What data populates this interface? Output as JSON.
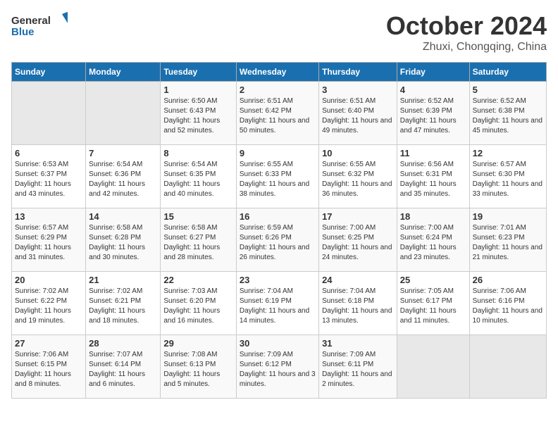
{
  "header": {
    "logo_line1": "General",
    "logo_line2": "Blue",
    "month": "October 2024",
    "location": "Zhuxi, Chongqing, China"
  },
  "weekdays": [
    "Sunday",
    "Monday",
    "Tuesday",
    "Wednesday",
    "Thursday",
    "Friday",
    "Saturday"
  ],
  "weeks": [
    [
      {
        "day": "",
        "empty": true
      },
      {
        "day": "",
        "empty": true
      },
      {
        "day": "1",
        "sunrise": "6:50 AM",
        "sunset": "6:43 PM",
        "daylight": "11 hours and 52 minutes."
      },
      {
        "day": "2",
        "sunrise": "6:51 AM",
        "sunset": "6:42 PM",
        "daylight": "11 hours and 50 minutes."
      },
      {
        "day": "3",
        "sunrise": "6:51 AM",
        "sunset": "6:40 PM",
        "daylight": "11 hours and 49 minutes."
      },
      {
        "day": "4",
        "sunrise": "6:52 AM",
        "sunset": "6:39 PM",
        "daylight": "11 hours and 47 minutes."
      },
      {
        "day": "5",
        "sunrise": "6:52 AM",
        "sunset": "6:38 PM",
        "daylight": "11 hours and 45 minutes."
      }
    ],
    [
      {
        "day": "6",
        "sunrise": "6:53 AM",
        "sunset": "6:37 PM",
        "daylight": "11 hours and 43 minutes."
      },
      {
        "day": "7",
        "sunrise": "6:54 AM",
        "sunset": "6:36 PM",
        "daylight": "11 hours and 42 minutes."
      },
      {
        "day": "8",
        "sunrise": "6:54 AM",
        "sunset": "6:35 PM",
        "daylight": "11 hours and 40 minutes."
      },
      {
        "day": "9",
        "sunrise": "6:55 AM",
        "sunset": "6:33 PM",
        "daylight": "11 hours and 38 minutes."
      },
      {
        "day": "10",
        "sunrise": "6:55 AM",
        "sunset": "6:32 PM",
        "daylight": "11 hours and 36 minutes."
      },
      {
        "day": "11",
        "sunrise": "6:56 AM",
        "sunset": "6:31 PM",
        "daylight": "11 hours and 35 minutes."
      },
      {
        "day": "12",
        "sunrise": "6:57 AM",
        "sunset": "6:30 PM",
        "daylight": "11 hours and 33 minutes."
      }
    ],
    [
      {
        "day": "13",
        "sunrise": "6:57 AM",
        "sunset": "6:29 PM",
        "daylight": "11 hours and 31 minutes."
      },
      {
        "day": "14",
        "sunrise": "6:58 AM",
        "sunset": "6:28 PM",
        "daylight": "11 hours and 30 minutes."
      },
      {
        "day": "15",
        "sunrise": "6:58 AM",
        "sunset": "6:27 PM",
        "daylight": "11 hours and 28 minutes."
      },
      {
        "day": "16",
        "sunrise": "6:59 AM",
        "sunset": "6:26 PM",
        "daylight": "11 hours and 26 minutes."
      },
      {
        "day": "17",
        "sunrise": "7:00 AM",
        "sunset": "6:25 PM",
        "daylight": "11 hours and 24 minutes."
      },
      {
        "day": "18",
        "sunrise": "7:00 AM",
        "sunset": "6:24 PM",
        "daylight": "11 hours and 23 minutes."
      },
      {
        "day": "19",
        "sunrise": "7:01 AM",
        "sunset": "6:23 PM",
        "daylight": "11 hours and 21 minutes."
      }
    ],
    [
      {
        "day": "20",
        "sunrise": "7:02 AM",
        "sunset": "6:22 PM",
        "daylight": "11 hours and 19 minutes."
      },
      {
        "day": "21",
        "sunrise": "7:02 AM",
        "sunset": "6:21 PM",
        "daylight": "11 hours and 18 minutes."
      },
      {
        "day": "22",
        "sunrise": "7:03 AM",
        "sunset": "6:20 PM",
        "daylight": "11 hours and 16 minutes."
      },
      {
        "day": "23",
        "sunrise": "7:04 AM",
        "sunset": "6:19 PM",
        "daylight": "11 hours and 14 minutes."
      },
      {
        "day": "24",
        "sunrise": "7:04 AM",
        "sunset": "6:18 PM",
        "daylight": "11 hours and 13 minutes."
      },
      {
        "day": "25",
        "sunrise": "7:05 AM",
        "sunset": "6:17 PM",
        "daylight": "11 hours and 11 minutes."
      },
      {
        "day": "26",
        "sunrise": "7:06 AM",
        "sunset": "6:16 PM",
        "daylight": "11 hours and 10 minutes."
      }
    ],
    [
      {
        "day": "27",
        "sunrise": "7:06 AM",
        "sunset": "6:15 PM",
        "daylight": "11 hours and 8 minutes."
      },
      {
        "day": "28",
        "sunrise": "7:07 AM",
        "sunset": "6:14 PM",
        "daylight": "11 hours and 6 minutes."
      },
      {
        "day": "29",
        "sunrise": "7:08 AM",
        "sunset": "6:13 PM",
        "daylight": "11 hours and 5 minutes."
      },
      {
        "day": "30",
        "sunrise": "7:09 AM",
        "sunset": "6:12 PM",
        "daylight": "11 hours and 3 minutes."
      },
      {
        "day": "31",
        "sunrise": "7:09 AM",
        "sunset": "6:11 PM",
        "daylight": "11 hours and 2 minutes."
      },
      {
        "day": "",
        "empty": true
      },
      {
        "day": "",
        "empty": true
      }
    ]
  ],
  "labels": {
    "sunrise": "Sunrise:",
    "sunset": "Sunset:",
    "daylight": "Daylight:"
  }
}
